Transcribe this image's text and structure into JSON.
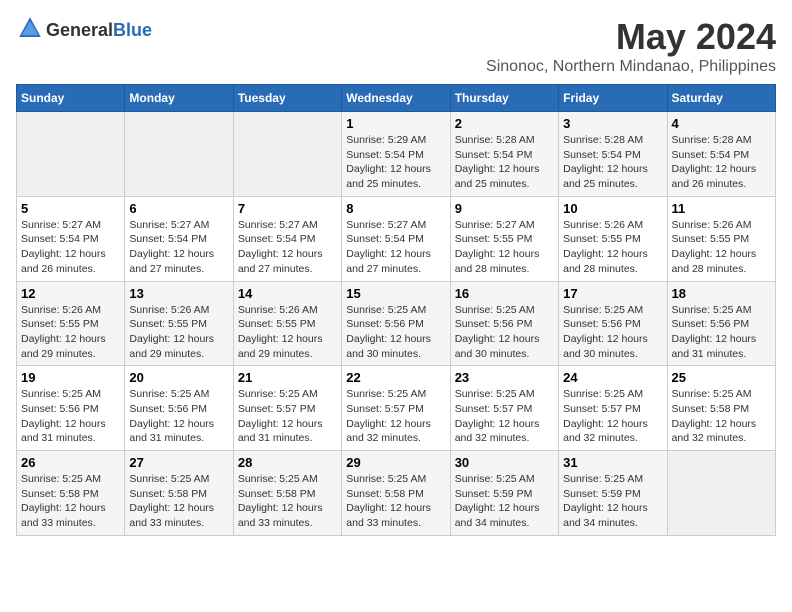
{
  "logo": {
    "text_general": "General",
    "text_blue": "Blue"
  },
  "title": "May 2024",
  "subtitle": "Sinonoc, Northern Mindanao, Philippines",
  "headers": [
    "Sunday",
    "Monday",
    "Tuesday",
    "Wednesday",
    "Thursday",
    "Friday",
    "Saturday"
  ],
  "weeks": [
    [
      {
        "day": "",
        "info": ""
      },
      {
        "day": "",
        "info": ""
      },
      {
        "day": "",
        "info": ""
      },
      {
        "day": "1",
        "info": "Sunrise: 5:29 AM\nSunset: 5:54 PM\nDaylight: 12 hours\nand 25 minutes."
      },
      {
        "day": "2",
        "info": "Sunrise: 5:28 AM\nSunset: 5:54 PM\nDaylight: 12 hours\nand 25 minutes."
      },
      {
        "day": "3",
        "info": "Sunrise: 5:28 AM\nSunset: 5:54 PM\nDaylight: 12 hours\nand 25 minutes."
      },
      {
        "day": "4",
        "info": "Sunrise: 5:28 AM\nSunset: 5:54 PM\nDaylight: 12 hours\nand 26 minutes."
      }
    ],
    [
      {
        "day": "5",
        "info": "Sunrise: 5:27 AM\nSunset: 5:54 PM\nDaylight: 12 hours\nand 26 minutes."
      },
      {
        "day": "6",
        "info": "Sunrise: 5:27 AM\nSunset: 5:54 PM\nDaylight: 12 hours\nand 27 minutes."
      },
      {
        "day": "7",
        "info": "Sunrise: 5:27 AM\nSunset: 5:54 PM\nDaylight: 12 hours\nand 27 minutes."
      },
      {
        "day": "8",
        "info": "Sunrise: 5:27 AM\nSunset: 5:54 PM\nDaylight: 12 hours\nand 27 minutes."
      },
      {
        "day": "9",
        "info": "Sunrise: 5:27 AM\nSunset: 5:55 PM\nDaylight: 12 hours\nand 28 minutes."
      },
      {
        "day": "10",
        "info": "Sunrise: 5:26 AM\nSunset: 5:55 PM\nDaylight: 12 hours\nand 28 minutes."
      },
      {
        "day": "11",
        "info": "Sunrise: 5:26 AM\nSunset: 5:55 PM\nDaylight: 12 hours\nand 28 minutes."
      }
    ],
    [
      {
        "day": "12",
        "info": "Sunrise: 5:26 AM\nSunset: 5:55 PM\nDaylight: 12 hours\nand 29 minutes."
      },
      {
        "day": "13",
        "info": "Sunrise: 5:26 AM\nSunset: 5:55 PM\nDaylight: 12 hours\nand 29 minutes."
      },
      {
        "day": "14",
        "info": "Sunrise: 5:26 AM\nSunset: 5:55 PM\nDaylight: 12 hours\nand 29 minutes."
      },
      {
        "day": "15",
        "info": "Sunrise: 5:25 AM\nSunset: 5:56 PM\nDaylight: 12 hours\nand 30 minutes."
      },
      {
        "day": "16",
        "info": "Sunrise: 5:25 AM\nSunset: 5:56 PM\nDaylight: 12 hours\nand 30 minutes."
      },
      {
        "day": "17",
        "info": "Sunrise: 5:25 AM\nSunset: 5:56 PM\nDaylight: 12 hours\nand 30 minutes."
      },
      {
        "day": "18",
        "info": "Sunrise: 5:25 AM\nSunset: 5:56 PM\nDaylight: 12 hours\nand 31 minutes."
      }
    ],
    [
      {
        "day": "19",
        "info": "Sunrise: 5:25 AM\nSunset: 5:56 PM\nDaylight: 12 hours\nand 31 minutes."
      },
      {
        "day": "20",
        "info": "Sunrise: 5:25 AM\nSunset: 5:56 PM\nDaylight: 12 hours\nand 31 minutes."
      },
      {
        "day": "21",
        "info": "Sunrise: 5:25 AM\nSunset: 5:57 PM\nDaylight: 12 hours\nand 31 minutes."
      },
      {
        "day": "22",
        "info": "Sunrise: 5:25 AM\nSunset: 5:57 PM\nDaylight: 12 hours\nand 32 minutes."
      },
      {
        "day": "23",
        "info": "Sunrise: 5:25 AM\nSunset: 5:57 PM\nDaylight: 12 hours\nand 32 minutes."
      },
      {
        "day": "24",
        "info": "Sunrise: 5:25 AM\nSunset: 5:57 PM\nDaylight: 12 hours\nand 32 minutes."
      },
      {
        "day": "25",
        "info": "Sunrise: 5:25 AM\nSunset: 5:58 PM\nDaylight: 12 hours\nand 32 minutes."
      }
    ],
    [
      {
        "day": "26",
        "info": "Sunrise: 5:25 AM\nSunset: 5:58 PM\nDaylight: 12 hours\nand 33 minutes."
      },
      {
        "day": "27",
        "info": "Sunrise: 5:25 AM\nSunset: 5:58 PM\nDaylight: 12 hours\nand 33 minutes."
      },
      {
        "day": "28",
        "info": "Sunrise: 5:25 AM\nSunset: 5:58 PM\nDaylight: 12 hours\nand 33 minutes."
      },
      {
        "day": "29",
        "info": "Sunrise: 5:25 AM\nSunset: 5:58 PM\nDaylight: 12 hours\nand 33 minutes."
      },
      {
        "day": "30",
        "info": "Sunrise: 5:25 AM\nSunset: 5:59 PM\nDaylight: 12 hours\nand 34 minutes."
      },
      {
        "day": "31",
        "info": "Sunrise: 5:25 AM\nSunset: 5:59 PM\nDaylight: 12 hours\nand 34 minutes."
      },
      {
        "day": "",
        "info": ""
      }
    ]
  ]
}
